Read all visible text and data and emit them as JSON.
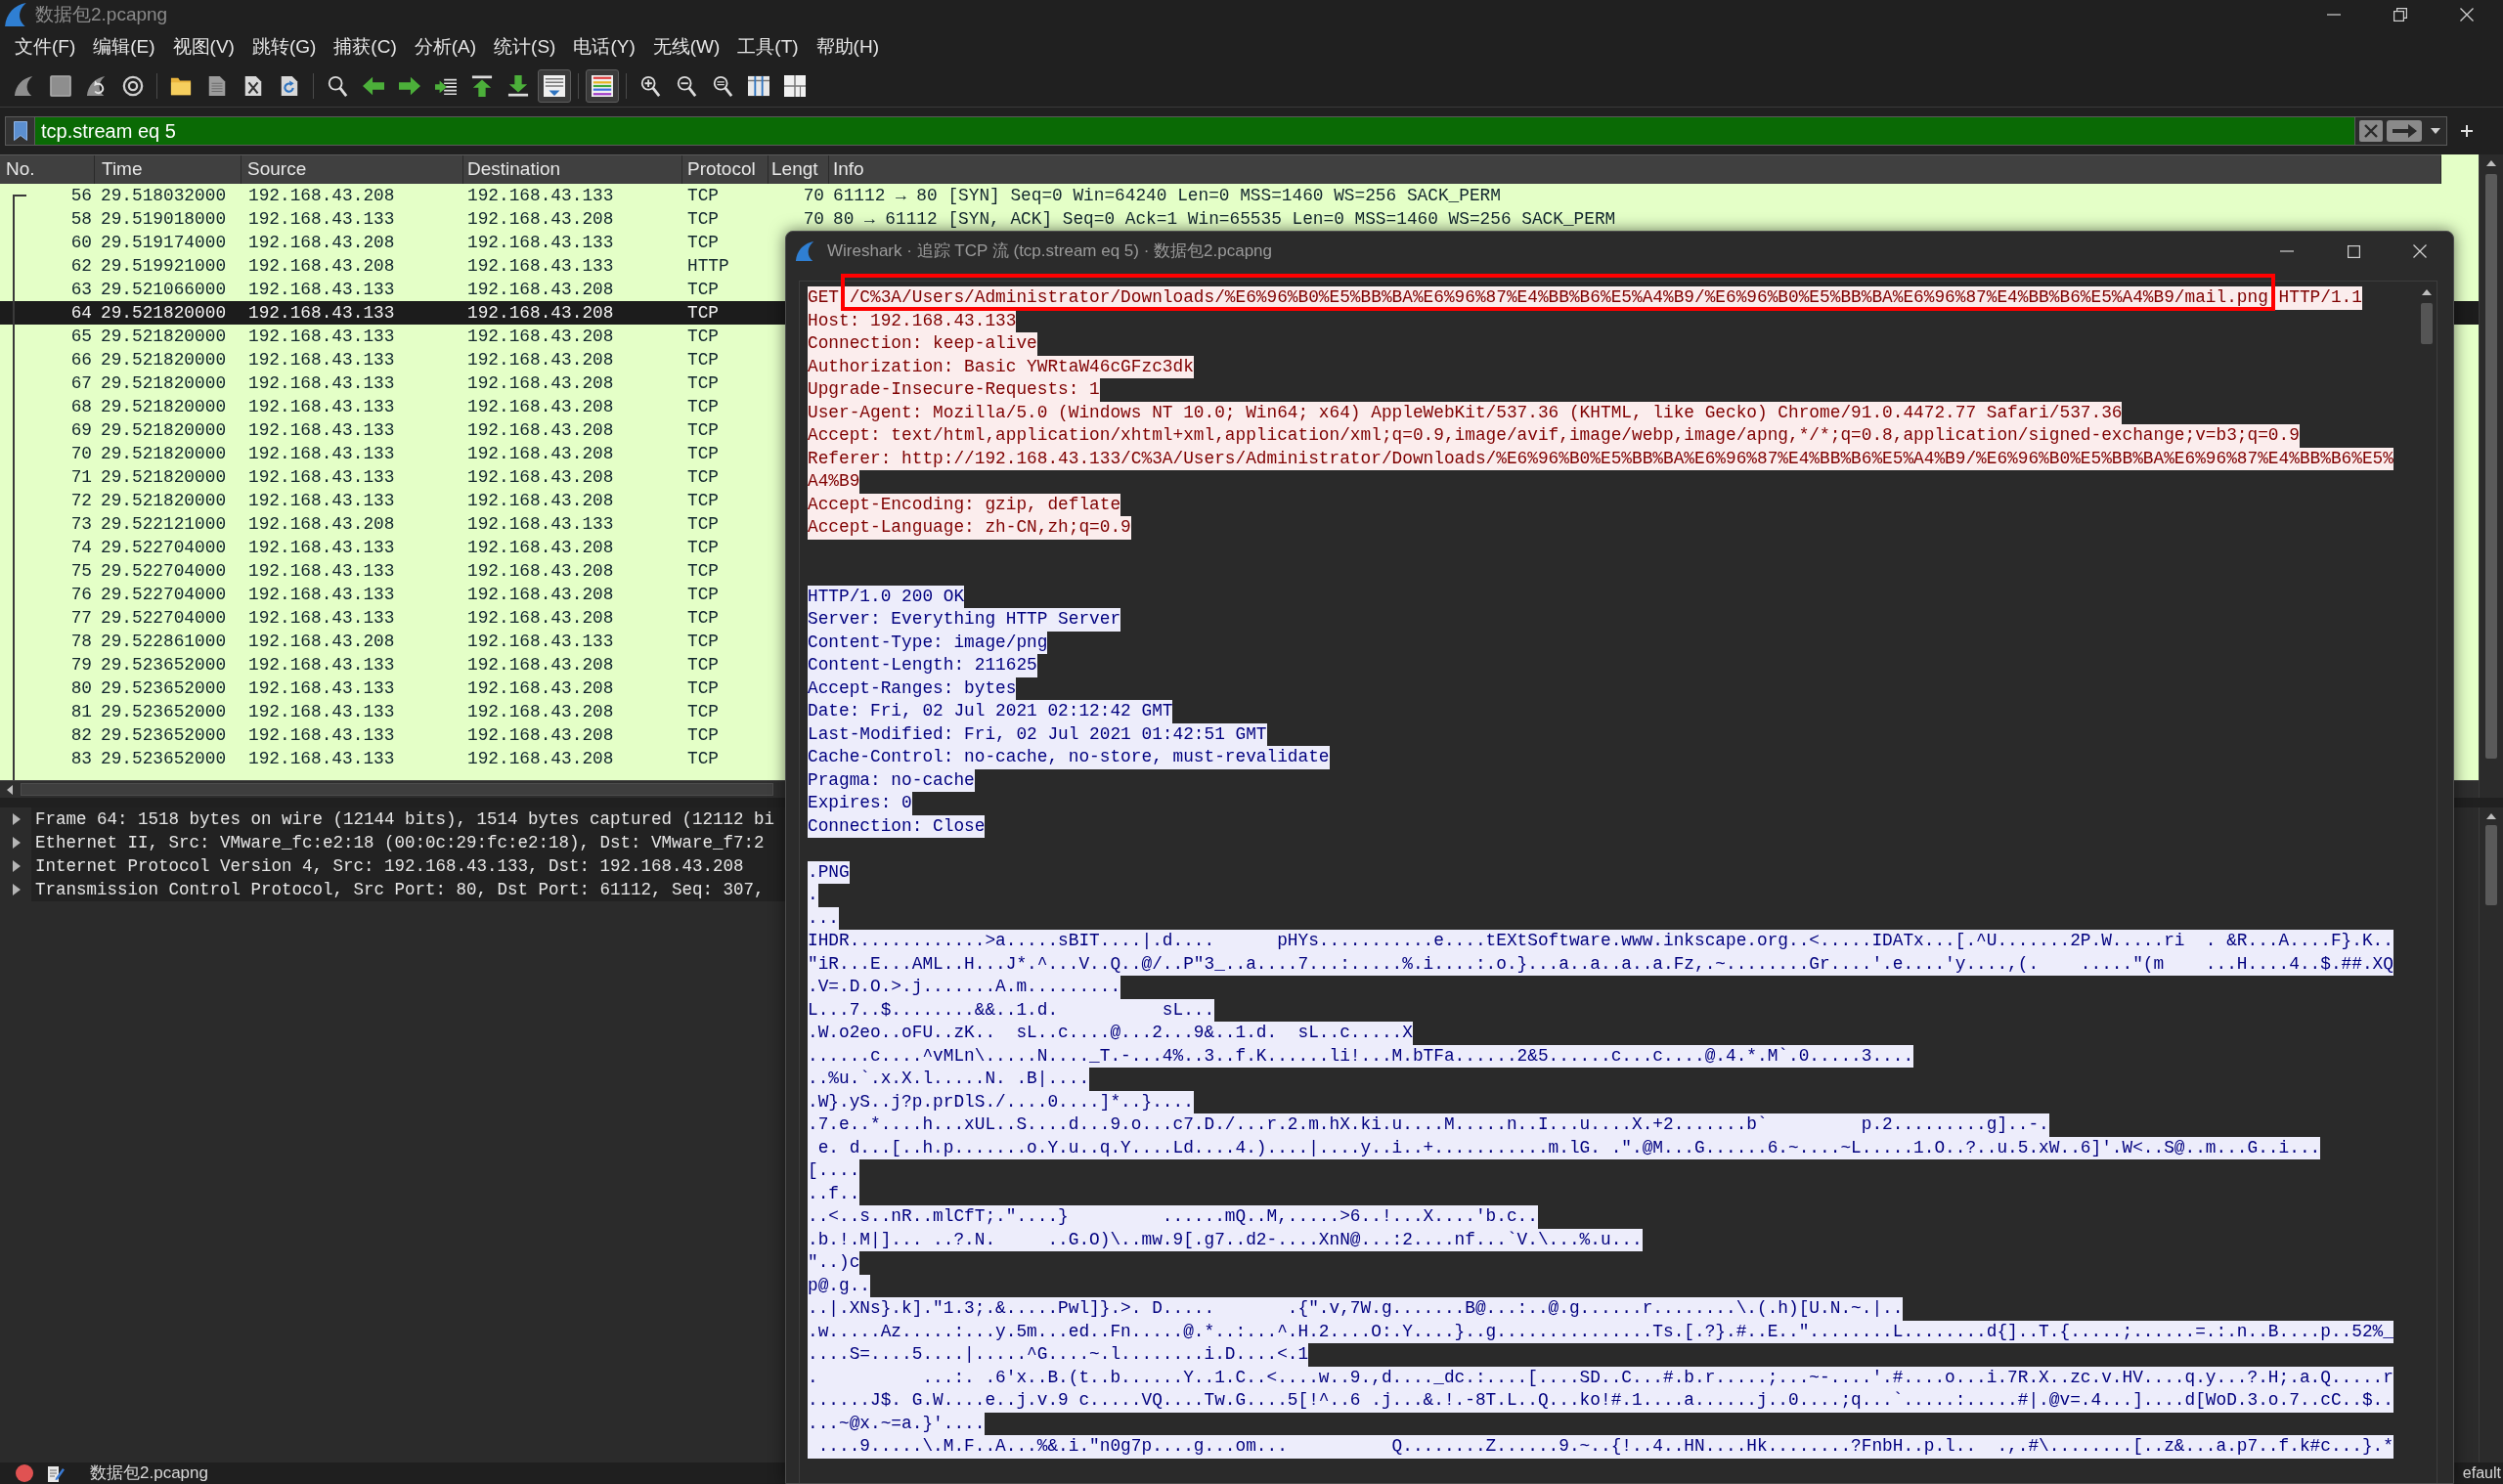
{
  "window": {
    "title": "数据包2.pcapng"
  },
  "menu": [
    "文件(F)",
    "编辑(E)",
    "视图(V)",
    "跳转(G)",
    "捕获(C)",
    "分析(A)",
    "统计(S)",
    "电话(Y)",
    "无线(W)",
    "工具(T)",
    "帮助(H)"
  ],
  "toolbar_groups": [
    {
      "buttons": [
        {
          "kind": "fin",
          "pressed": false
        },
        {
          "kind": "stop",
          "pressed": false
        },
        {
          "kind": "restart",
          "pressed": false
        },
        {
          "kind": "options",
          "pressed": false
        }
      ]
    },
    {
      "buttons": [
        {
          "kind": "open",
          "pressed": false
        },
        {
          "kind": "file",
          "pressed": false
        },
        {
          "kind": "closefile",
          "pressed": false
        },
        {
          "kind": "reload",
          "pressed": false
        }
      ]
    },
    {
      "buttons": [
        {
          "kind": "find",
          "pressed": false
        },
        {
          "kind": "back",
          "pressed": false
        },
        {
          "kind": "forward",
          "pressed": false
        },
        {
          "kind": "goto",
          "pressed": false
        },
        {
          "kind": "first",
          "pressed": false
        },
        {
          "kind": "last",
          "pressed": false
        },
        {
          "kind": "autoscroll",
          "pressed": true
        }
      ]
    },
    {
      "buttons": [
        {
          "kind": "colorize",
          "pressed": true
        }
      ]
    },
    {
      "buttons": [
        {
          "kind": "zoomin",
          "pressed": false
        },
        {
          "kind": "zoomout",
          "pressed": false
        },
        {
          "kind": "zoomreset",
          "pressed": false
        },
        {
          "kind": "resize",
          "pressed": false
        },
        {
          "kind": "layout",
          "pressed": false
        }
      ]
    }
  ],
  "filter": {
    "value": "tcp.stream eq 5",
    "valid": true
  },
  "packet_list": {
    "columns": [
      "No.",
      "Time",
      "Source",
      "Destination",
      "Protocol",
      "Lengt",
      "Info"
    ],
    "rows": [
      {
        "no": "56",
        "time": "29.518032000",
        "source": "192.168.43.208",
        "destination": "192.168.43.133",
        "protocol": "TCP",
        "length": "70",
        "info": "61112 → 80 [SYN] Seq=0 Win=64240 Len=0 MSS=1460 WS=256 SACK_PERM",
        "selected": false
      },
      {
        "no": "58",
        "time": "29.519018000",
        "source": "192.168.43.133",
        "destination": "192.168.43.208",
        "protocol": "TCP",
        "length": "70",
        "info": "80 → 61112 [SYN, ACK] Seq=0 Ack=1 Win=65535 Len=0 MSS=1460 WS=256 SACK_PERM",
        "selected": false
      },
      {
        "no": "60",
        "time": "29.519174000",
        "source": "192.168.43.208",
        "destination": "192.168.43.133",
        "protocol": "TCP",
        "selected": false
      },
      {
        "no": "62",
        "time": "29.519921000",
        "source": "192.168.43.208",
        "destination": "192.168.43.133",
        "protocol": "HTTP",
        "selected": false
      },
      {
        "no": "63",
        "time": "29.521066000",
        "source": "192.168.43.133",
        "destination": "192.168.43.208",
        "protocol": "TCP",
        "selected": false
      },
      {
        "no": "64",
        "time": "29.521820000",
        "source": "192.168.43.133",
        "destination": "192.168.43.208",
        "protocol": "TCP",
        "selected": true
      },
      {
        "no": "65",
        "time": "29.521820000",
        "source": "192.168.43.133",
        "destination": "192.168.43.208",
        "protocol": "TCP",
        "selected": false
      },
      {
        "no": "66",
        "time": "29.521820000",
        "source": "192.168.43.133",
        "destination": "192.168.43.208",
        "protocol": "TCP",
        "selected": false
      },
      {
        "no": "67",
        "time": "29.521820000",
        "source": "192.168.43.133",
        "destination": "192.168.43.208",
        "protocol": "TCP",
        "selected": false
      },
      {
        "no": "68",
        "time": "29.521820000",
        "source": "192.168.43.133",
        "destination": "192.168.43.208",
        "protocol": "TCP",
        "selected": false
      },
      {
        "no": "69",
        "time": "29.521820000",
        "source": "192.168.43.133",
        "destination": "192.168.43.208",
        "protocol": "TCP",
        "selected": false
      },
      {
        "no": "70",
        "time": "29.521820000",
        "source": "192.168.43.133",
        "destination": "192.168.43.208",
        "protocol": "TCP",
        "selected": false
      },
      {
        "no": "71",
        "time": "29.521820000",
        "source": "192.168.43.133",
        "destination": "192.168.43.208",
        "protocol": "TCP",
        "selected": false
      },
      {
        "no": "72",
        "time": "29.521820000",
        "source": "192.168.43.133",
        "destination": "192.168.43.208",
        "protocol": "TCP",
        "selected": false
      },
      {
        "no": "73",
        "time": "29.522121000",
        "source": "192.168.43.208",
        "destination": "192.168.43.133",
        "protocol": "TCP",
        "selected": false
      },
      {
        "no": "74",
        "time": "29.522704000",
        "source": "192.168.43.133",
        "destination": "192.168.43.208",
        "protocol": "TCP",
        "selected": false
      },
      {
        "no": "75",
        "time": "29.522704000",
        "source": "192.168.43.133",
        "destination": "192.168.43.208",
        "protocol": "TCP",
        "selected": false
      },
      {
        "no": "76",
        "time": "29.522704000",
        "source": "192.168.43.133",
        "destination": "192.168.43.208",
        "protocol": "TCP",
        "selected": false
      },
      {
        "no": "77",
        "time": "29.522704000",
        "source": "192.168.43.133",
        "destination": "192.168.43.208",
        "protocol": "TCP",
        "selected": false
      },
      {
        "no": "78",
        "time": "29.522861000",
        "source": "192.168.43.208",
        "destination": "192.168.43.133",
        "protocol": "TCP",
        "selected": false
      },
      {
        "no": "79",
        "time": "29.523652000",
        "source": "192.168.43.133",
        "destination": "192.168.43.208",
        "protocol": "TCP",
        "selected": false
      },
      {
        "no": "80",
        "time": "29.523652000",
        "source": "192.168.43.133",
        "destination": "192.168.43.208",
        "protocol": "TCP",
        "selected": false
      },
      {
        "no": "81",
        "time": "29.523652000",
        "source": "192.168.43.133",
        "destination": "192.168.43.208",
        "protocol": "TCP",
        "selected": false
      },
      {
        "no": "82",
        "time": "29.523652000",
        "source": "192.168.43.133",
        "destination": "192.168.43.208",
        "protocol": "TCP",
        "selected": false
      },
      {
        "no": "83",
        "time": "29.523652000",
        "source": "192.168.43.133",
        "destination": "192.168.43.208",
        "protocol": "TCP",
        "selected": false
      }
    ]
  },
  "packet_details": [
    {
      "text": "Frame 64: 1518 bytes on wire (12144 bits), 1514 bytes captured (12112 bi",
      "expanded": false
    },
    {
      "text": "Ethernet II, Src: VMware_fc:e2:18 (00:0c:29:fc:e2:18), Dst: VMware_f7:2",
      "expanded": false
    },
    {
      "text": "Internet Protocol Version 4, Src: 192.168.43.133, Dst: 192.168.43.208",
      "expanded": false
    },
    {
      "text": "Transmission Control Protocol, Src Port: 80, Dst Port: 61112, Seq: 307,",
      "expanded": false
    }
  ],
  "status_bar": {
    "file": "数据包2.pcapng",
    "profile": "efault"
  },
  "follow_window": {
    "title": "Wireshark · 追踪 TCP 流 (tcp.stream eq 5) · 数据包2.pcapng",
    "request": {
      "request_line": [
        {
          "text": "GET",
          "framed": false
        },
        {
          "text": "/C%3A/Users/Administrator/Downloads/%E6%96%B0%E5%BB%BA%E6%96%87%E4%BB%B6%E5%A4%B9/%E6%96%B0%E5%BB%BA%E6%96%87%E4%BB%B6%E5%A4%B9/mail.png",
          "framed": true
        },
        {
          "text": "HTTP/1.1",
          "framed": false
        }
      ],
      "headers": [
        "Host: 192.168.43.133",
        "Connection: keep-alive",
        "Authorization: Basic YWRtaW46cGFzc3dk",
        "Upgrade-Insecure-Requests: 1",
        "User-Agent: Mozilla/5.0 (Windows NT 10.0; Win64; x64) AppleWebKit/537.36 (KHTML, like Gecko) Chrome/91.0.4472.77 Safari/537.36",
        "Accept: text/html,application/xhtml+xml,application/xml;q=0.9,image/avif,image/webp,image/apng,*/*;q=0.8,application/signed-exchange;v=b3;q=0.9",
        "Referer: http://192.168.43.133/C%3A/Users/Administrator/Downloads/%E6%96%B0%E5%BB%BA%E6%96%87%E4%BB%B6%E5%A4%B9/%E6%96%B0%E5%BB%BA%E6%96%87%E4%BB%B6%E5%",
        "A4%B9",
        "Accept-Encoding: gzip, deflate",
        "Accept-Language: zh-CN,zh;q=0.9"
      ]
    },
    "response": {
      "headers": [
        "HTTP/1.0 200 OK",
        "Server: Everything HTTP Server",
        "Content-Type: image/png",
        "Content-Length: 211625",
        "Accept-Ranges: bytes",
        "Date: Fri, 02 Jul 2021 02:12:42 GMT",
        "Last-Modified: Fri, 02 Jul 2021 01:42:51 GMT",
        "Cache-Control: no-cache, no-store, must-revalidate",
        "Pragma: no-cache",
        "Expires: 0",
        "Connection: Close"
      ],
      "body": [
        ".PNG",
        ".",
        "...",
        "IHDR.............>a.....sBIT....|.d....      pHYs...........e....tEXtSoftware.www.inkscape.org..<.....IDATx...[.^U.......2P.W.....ri  . &R...A....F}.K..",
        "\"iR...E...AML..H...J*.^...V..Q..@/..P\"3_..a....7...:.....%.i....:.o.}...a..a..a..a.Fz,.~........Gr....'.e....'y....,(.    .....\"(m    ...H....4..$.##.XQ",
        ".V=.D.O.>.j.......A.m.........",
        "L...7..$........&&..1.d.          sL...",
        ".W.o2eo..oFU..zK..  sL..c....@...2...9&..1.d.  sL..c.....X",
        "......c....^vMLn\\.....N...._T.-...4%..3..f.K......li!...M.bTFa......2&5......c...c....@.4.*.M`.0.....3....",
        "..%u.`.x.X.l.....N. .B|....",
        ".W}.yS..j?p.prDlS./....0....]*..}....",
        ".7.e..*....h...xUL..S....d...9.o...c7.D./...r.2.m.hX.ki.u....M.....n..I...u....X.+2.......b`         p.2.........g]..-.",
        " e. d...[..h.p.......o.Y.u..q.Y....Ld....4.)....|....y..i..+...........m.lG. .\".@M...G......6.~....~L.....1.O..?..u.5.xW..6]'.W<..S@..m...G..i...",
        "[....",
        "..f..",
        "..<..s..nR..mlCfT;.\"....}         ......mQ..M,.....>6..!...X....'b.c..",
        ".b.!.M|]... ..?.N.     ..G.O)\\..mw.9[.g7..d2-....XnN@...:2....nf...`V.\\...%.u...",
        "\"..)c",
        "p@.g..",
        "..|.XNs}.k].\"1.3;.&.....Pwl]}.>. D.....       .{\".v,7W.g.......B@...:..@.g......r........\\.(.h)[U.N.~.|..",
        ".w.....Az.....:...y.5m...ed..Fn.....@.*..:...^.H.2....O:.Y....}..g...............Ts.[.?}.#..E..\"........L........d{]..T.{.....;......=.:.n..B....p..52%_",
        "....S=....5....|.....^G....~.l........i.D....<.1",
        ".          ...:. .6'x..B.(t..b......Y..1.C..<....w..9.,d...._dc.:....[....SD..C...#.b.r.....;...~-....'.#....o...i.7R.X..zc.v.HV....q.y...?.H;.a.Q.....r",
        "......J$. G.W....e..j.v.9 c.....VQ....Tw.G....5[!^..6 .j...&.!.-8T.L..Q...ko!#.1....a......j..0....;q...`.....:.....#|.@v=.4...]....d[WoD.3.o.7..cC..$..",
        "...~@x.~=a.}'....",
        " ....9.....\\.M.F..A...%&.i.\"n0g7p....g...om...          Q........Z......9.~..{!..4..HN....Hk........?FnbH..p.l..  .,.#\\........[..z&...a.p7..f.k#c...}.*"
      ]
    }
  }
}
